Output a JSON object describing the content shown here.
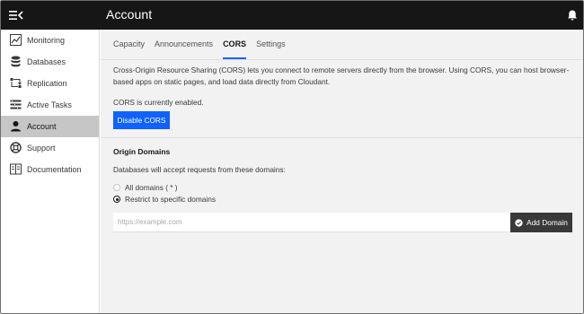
{
  "header": {
    "title": "Account",
    "menu_icon": "menu-collapse-icon",
    "notification_icon": "bell-icon"
  },
  "sidebar": {
    "items": [
      {
        "label": "Monitoring",
        "icon": "chart-line-icon",
        "active": false
      },
      {
        "label": "Databases",
        "icon": "database-icon",
        "active": false
      },
      {
        "label": "Replication",
        "icon": "replicate-icon",
        "active": false
      },
      {
        "label": "Active Tasks",
        "icon": "task-list-icon",
        "active": false
      },
      {
        "label": "Account",
        "icon": "user-icon",
        "active": true
      },
      {
        "label": "Support",
        "icon": "lifebuoy-icon",
        "active": false
      },
      {
        "label": "Documentation",
        "icon": "book-icon",
        "active": false
      }
    ]
  },
  "tabs": [
    {
      "label": "Capacity",
      "active": false
    },
    {
      "label": "Announcements",
      "active": false
    },
    {
      "label": "CORS",
      "active": true
    },
    {
      "label": "Settings",
      "active": false
    }
  ],
  "cors": {
    "description": "Cross-Origin Resource Sharing (CORS) lets you connect to remote servers directly from the browser. Using CORS, you can host browser-based apps on static pages, and load data directly from Cloudant.",
    "status": "CORS is currently enabled.",
    "disable_label": "Disable CORS"
  },
  "origin": {
    "title": "Origin Domains",
    "description": "Databases will accept requests from these domains:",
    "options": [
      {
        "label": "All domains ( * )",
        "checked": false
      },
      {
        "label": "Restrict to specific domains",
        "checked": true
      }
    ],
    "input_placeholder": "https://example.com",
    "input_value": "",
    "add_label": "Add Domain"
  },
  "colors": {
    "header_bg": "#161616",
    "accent": "#0f62fe",
    "secondary_button": "#393939",
    "active_nav": "#c6c6c6",
    "main_bg": "#f2f2f2"
  }
}
